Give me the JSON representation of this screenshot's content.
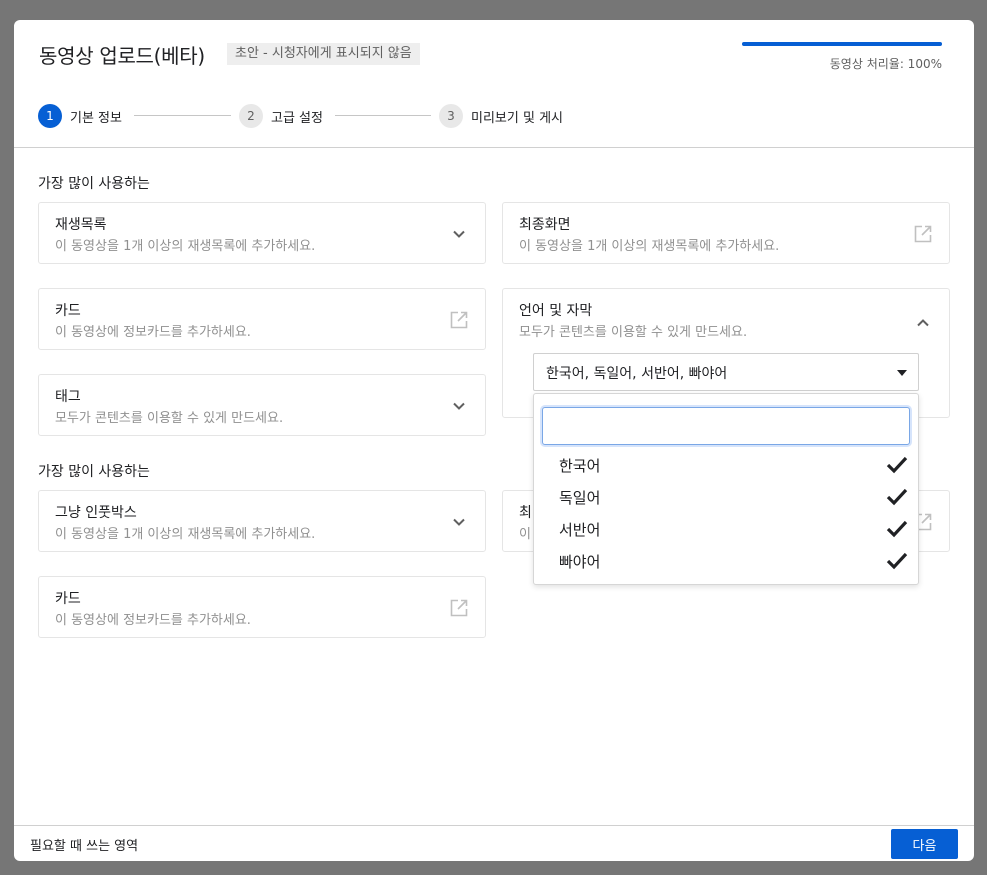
{
  "dialog": {
    "title": "동영상 업로드(베타)",
    "draft_badge": "초안 - 시청자에게 표시되지 않음",
    "progress": {
      "label": "동영상 처리율: 100%",
      "value": 1.0
    }
  },
  "stepper": {
    "steps": [
      {
        "number": "1",
        "label": "기본 정보",
        "active": true
      },
      {
        "number": "2",
        "label": "고급 설정",
        "active": false
      },
      {
        "number": "3",
        "label": "미리보기 및 게시",
        "active": false
      }
    ]
  },
  "sections": [
    {
      "heading": "가장 많이 사용하는",
      "cards": [
        {
          "title": "재생목록",
          "desc": "이 동영상을 1개 이상의 재생목록에 추가하세요.",
          "icon": "chevron-down-icon"
        },
        {
          "title": "최종화면",
          "desc": "이 동영상을 1개 이상의 재생목록에 추가하세요.",
          "icon": "external-link-icon"
        },
        {
          "title": "카드",
          "desc": "이 동영상에 정보카드를 추가하세요.",
          "icon": "external-link-icon"
        },
        {
          "title": "언어 및 자막",
          "desc": "모두가 콘텐츠를 이용할 수 있게 만드세요.",
          "icon": "chevron-up-icon"
        },
        {
          "title": "태그",
          "desc": "모두가 콘텐츠를 이용할 수 있게 만드세요.",
          "icon": "chevron-down-icon"
        }
      ]
    },
    {
      "heading": "가장 많이 사용하는",
      "cards": [
        {
          "title": "그냥 인풋박스",
          "desc": "이 동영상을 1개 이상의 재생목록에 추가하세요.",
          "icon": "chevron-down-icon"
        },
        {
          "title": "최",
          "desc": "이",
          "icon": "external-link-icon"
        },
        {
          "title": "카드",
          "desc": "이 동영상에 정보카드를 추가하세요.",
          "icon": "external-link-icon"
        }
      ]
    }
  ],
  "language_select": {
    "value": "한국어, 독일어, 서반어, 빠야어",
    "search_value": "",
    "options": [
      {
        "label": "한국어",
        "checked": true
      },
      {
        "label": "독일어",
        "checked": true
      },
      {
        "label": "서반어",
        "checked": true
      },
      {
        "label": "빠야어",
        "checked": true
      }
    ]
  },
  "footer": {
    "text": "필요할 때 쓰는 영역",
    "next_label": "다음"
  },
  "colors": {
    "accent": "#065fd4",
    "overlay": "#767676",
    "muted_text": "#909090"
  }
}
